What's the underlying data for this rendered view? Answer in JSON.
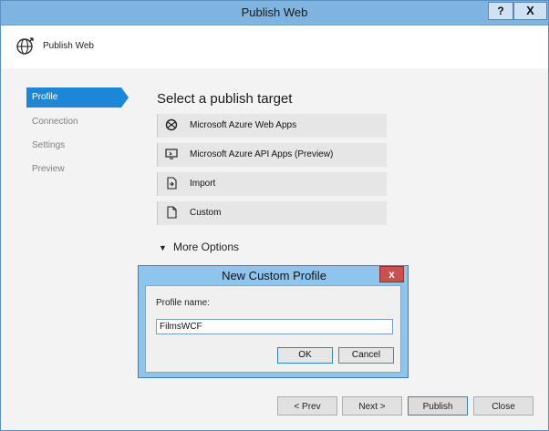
{
  "window": {
    "title": "Publish Web",
    "help_label": "?",
    "close_label": "X"
  },
  "header": {
    "title": "Publish Web",
    "icon": "globe-publish-icon"
  },
  "nav": {
    "items": [
      {
        "label": "Profile",
        "active": true
      },
      {
        "label": "Connection",
        "active": false
      },
      {
        "label": "Settings",
        "active": false
      },
      {
        "label": "Preview",
        "active": false
      }
    ]
  },
  "main": {
    "heading": "Select a publish target",
    "targets": [
      {
        "label": "Microsoft Azure Web Apps",
        "icon": "azure-web-apps-icon"
      },
      {
        "label": "Microsoft Azure API Apps (Preview)",
        "icon": "azure-api-apps-icon"
      },
      {
        "label": "Import",
        "icon": "import-icon"
      },
      {
        "label": "Custom",
        "icon": "custom-file-icon"
      }
    ],
    "more_options": "More Options"
  },
  "footer": {
    "prev": "< Prev",
    "next": "Next >",
    "publish": "Publish",
    "close": "Close"
  },
  "dialog": {
    "title": "New Custom Profile",
    "close_label": "x",
    "profile_label": "Profile name:",
    "profile_value": "FilmsWCF",
    "ok": "OK",
    "cancel": "Cancel"
  },
  "colors": {
    "accent": "#1c86d8",
    "titlebar": "#7fb3e0",
    "dialog_frame": "#8ec5ef"
  }
}
